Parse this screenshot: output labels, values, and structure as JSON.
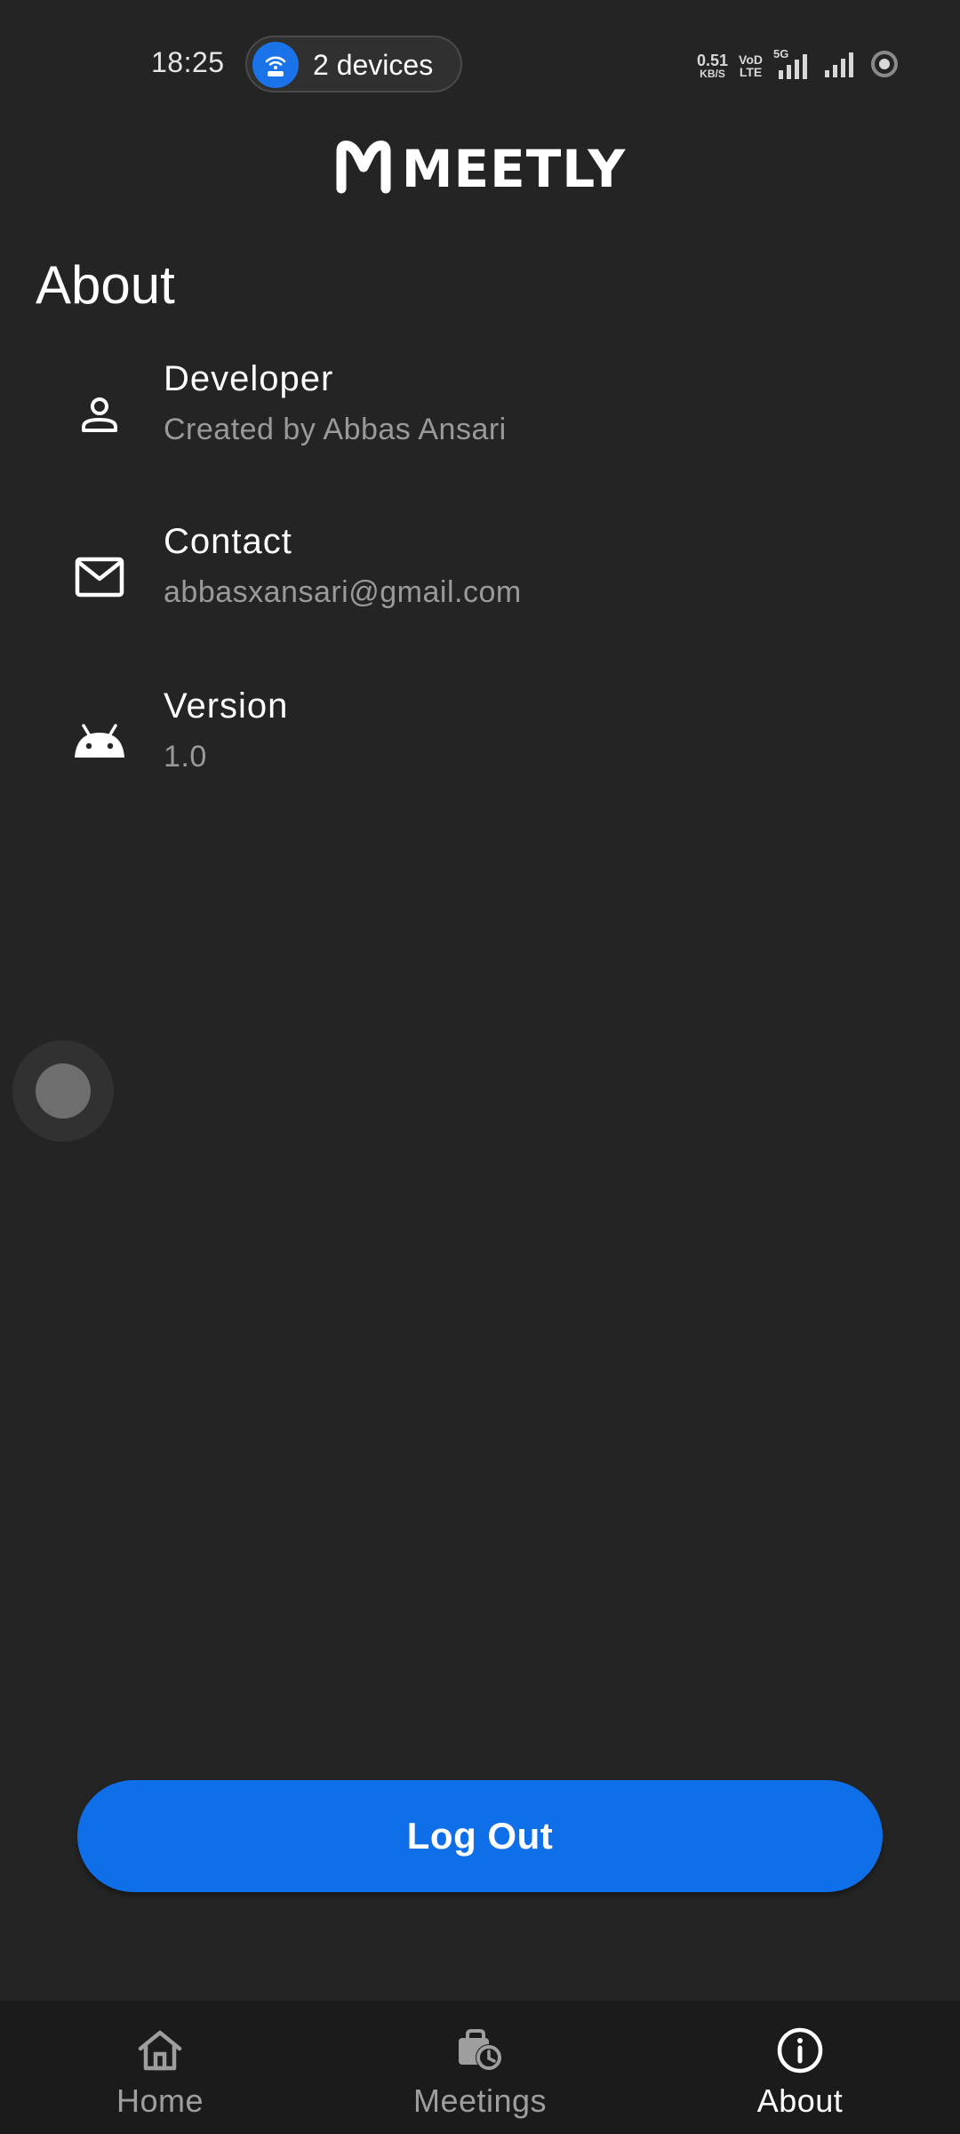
{
  "status_bar": {
    "time": "18:25",
    "devices_label": "2 devices",
    "net_speed_value": "0.51",
    "net_speed_unit": "KB/S",
    "volte_top": "VoD",
    "volte_bottom": "LTE",
    "network_type": "5G"
  },
  "header": {
    "logo_text": "MEETLY"
  },
  "page": {
    "title": "About"
  },
  "items": [
    {
      "title": "Developer",
      "subtitle": "Created by Abbas Ansari",
      "icon": "person-icon"
    },
    {
      "title": "Contact",
      "subtitle": "abbasxansari@gmail.com",
      "icon": "mail-icon"
    },
    {
      "title": "Version",
      "subtitle": "1.0",
      "icon": "android-icon"
    }
  ],
  "logout": {
    "label": "Log Out"
  },
  "bottom_nav": {
    "items": [
      {
        "label": "Home",
        "icon": "home-icon",
        "active": false
      },
      {
        "label": "Meetings",
        "icon": "meetings-icon",
        "active": false
      },
      {
        "label": "About",
        "icon": "info-icon",
        "active": true
      }
    ]
  },
  "colors": {
    "background": "#242424",
    "accent": "#0f6fe8",
    "nav_background": "#1b1b1b",
    "subtitle": "#9a9a9a"
  }
}
